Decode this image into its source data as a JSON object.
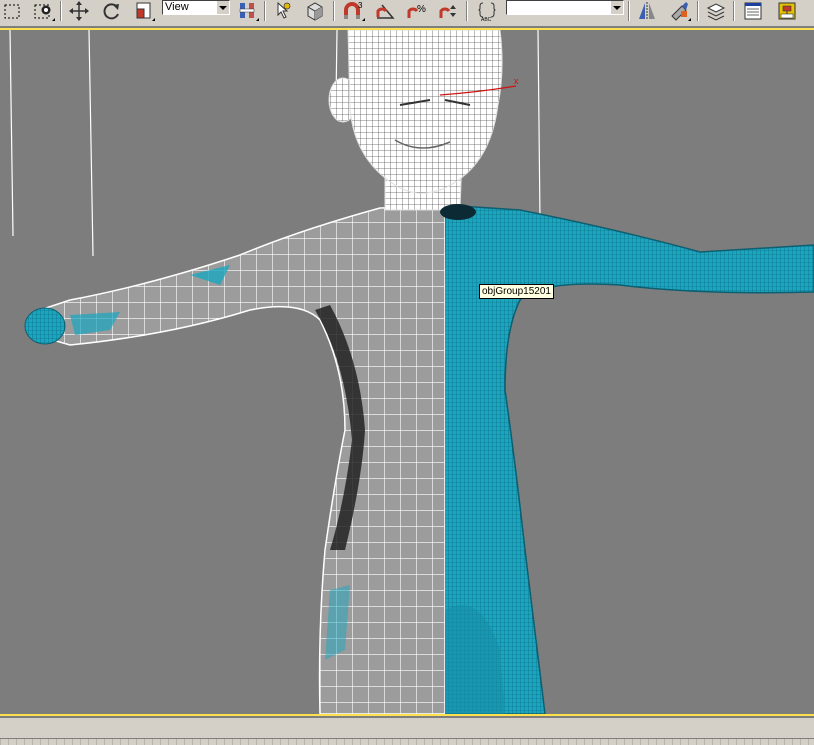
{
  "toolbar": {
    "reference_coord": "View",
    "named_selection": "",
    "icons": [
      "select-region-icon",
      "select-object-icon",
      "move-icon",
      "rotate-icon",
      "scale-icon",
      "pivot-center-icon",
      "select-manipulate-icon",
      "keyboard-shortcut-icon",
      "snap-3d-icon",
      "angle-snap-icon",
      "percent-snap-icon",
      "spinner-snap-icon",
      "edit-named-selection-icon",
      "mirror-icon",
      "align-icon",
      "layer-manager-icon",
      "curve-editor-icon",
      "schematic-view-icon"
    ]
  },
  "viewport": {
    "tooltip": "objGroup15201",
    "active_border_color": "#ffe14d",
    "background_color": "#7d7d7d",
    "selected_mesh_color": "#1aa6c0",
    "wireframe_color": "#ffffff"
  }
}
